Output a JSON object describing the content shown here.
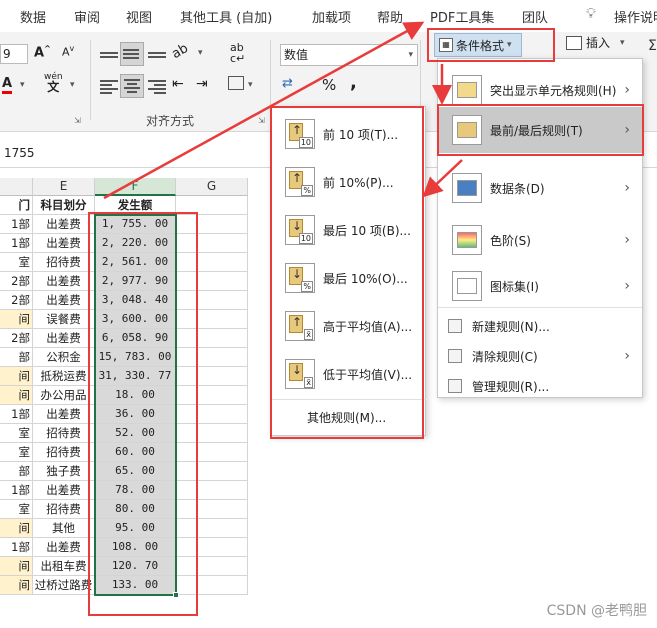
{
  "ribbon_tabs": [
    "数据",
    "审阅",
    "视图",
    "其他工具 (自加)",
    "加载项",
    "帮助",
    "PDF工具集",
    "团队",
    "操作说明"
  ],
  "ribbon": {
    "font_size": "9",
    "number_format": "数值",
    "group_alignment": "对齐方式",
    "cond_format_label": "条件格式",
    "insert_label": "插入",
    "percent_symbol": "%",
    "comma_symbol": ",",
    "wen_label": "wén"
  },
  "formula_bar": {
    "value": "1755"
  },
  "columns": [
    {
      "letter": "E",
      "header": "科目划分"
    },
    {
      "letter": "F",
      "header": "发生额"
    },
    {
      "letter": "G",
      "header": ""
    }
  ],
  "col_d_header": "门",
  "rows": [
    {
      "d": "1部",
      "e": "出差费",
      "f": "1, 755. 00",
      "hl": false
    },
    {
      "d": "1部",
      "e": "出差费",
      "f": "2, 220. 00",
      "hl": false
    },
    {
      "d": "室",
      "e": "招待费",
      "f": "2, 561. 00",
      "hl": false
    },
    {
      "d": "2部",
      "e": "出差费",
      "f": "2, 977. 90",
      "hl": false
    },
    {
      "d": "2部",
      "e": "出差费",
      "f": "3, 048. 40",
      "hl": false
    },
    {
      "d": "间",
      "e": "误餐费",
      "f": "3, 600. 00",
      "hl": true
    },
    {
      "d": "2部",
      "e": "出差费",
      "f": "6, 058. 90",
      "hl": false
    },
    {
      "d": "部",
      "e": "公积金",
      "f": "15, 783. 00",
      "hl": false
    },
    {
      "d": "间",
      "e": "抵税运费",
      "f": "31, 330. 77",
      "hl": true
    },
    {
      "d": "间",
      "e": "办公用品",
      "f": "18. 00",
      "hl": true
    },
    {
      "d": "1部",
      "e": "出差费",
      "f": "36. 00",
      "hl": false
    },
    {
      "d": "室",
      "e": "招待费",
      "f": "52. 00",
      "hl": false
    },
    {
      "d": "室",
      "e": "招待费",
      "f": "60. 00",
      "hl": false
    },
    {
      "d": "部",
      "e": "独子费",
      "f": "65. 00",
      "hl": false
    },
    {
      "d": "1部",
      "e": "出差费",
      "f": "78. 00",
      "hl": false
    },
    {
      "d": "室",
      "e": "招待费",
      "f": "80. 00",
      "hl": false
    },
    {
      "d": "间",
      "e": "其他",
      "f": "95. 00",
      "hl": true
    },
    {
      "d": "1部",
      "e": "出差费",
      "f": "108. 00",
      "hl": false
    },
    {
      "d": "间",
      "e": "出租车费",
      "f": "120. 70",
      "hl": true
    },
    {
      "d": "间",
      "e": "过桥过路费",
      "f": "133. 00",
      "hl": true
    }
  ],
  "cf_menu": [
    {
      "label": "突出显示单元格规则(H)",
      "icon": "highlight-rules-icon",
      "submenu": true
    },
    {
      "label": "最前/最后规则(T)",
      "icon": "top-bottom-rules-icon",
      "submenu": true,
      "active": true
    },
    {
      "label": "数据条(D)",
      "icon": "data-bars-icon",
      "submenu": true
    },
    {
      "label": "色阶(S)",
      "icon": "color-scales-icon",
      "submenu": true
    },
    {
      "label": "图标集(I)",
      "icon": "icon-sets-icon",
      "submenu": true
    },
    {
      "label": "新建规则(N)...",
      "icon": "new-rule-icon",
      "submenu": false
    },
    {
      "label": "清除规则(C)",
      "icon": "clear-rules-icon",
      "submenu": true
    },
    {
      "label": "管理规则(R)...",
      "icon": "manage-rules-icon",
      "submenu": false
    }
  ],
  "sub_menu": [
    {
      "label": "前 10 项(T)...",
      "badge": "10",
      "dir": "up"
    },
    {
      "label": "前 10%(P)...",
      "badge": "%",
      "dir": "up"
    },
    {
      "label": "最后 10 项(B)...",
      "badge": "10",
      "dir": "down"
    },
    {
      "label": "最后 10%(O)...",
      "badge": "%",
      "dir": "down"
    },
    {
      "label": "高于平均值(A)...",
      "badge": "x̄",
      "dir": "up"
    },
    {
      "label": "低于平均值(V)...",
      "badge": "x̄",
      "dir": "down"
    }
  ],
  "sub_menu_more": "其他规则(M)...",
  "watermark": "CSDN @老鸭胆",
  "colors": {
    "annotation_red": "#e83b3b",
    "highlight_yellow": "#fff2cc",
    "selected_gray": "#d9d9d9",
    "menu_active": "#c9c9c9",
    "cf_button_bg": "#cfe0f1"
  }
}
